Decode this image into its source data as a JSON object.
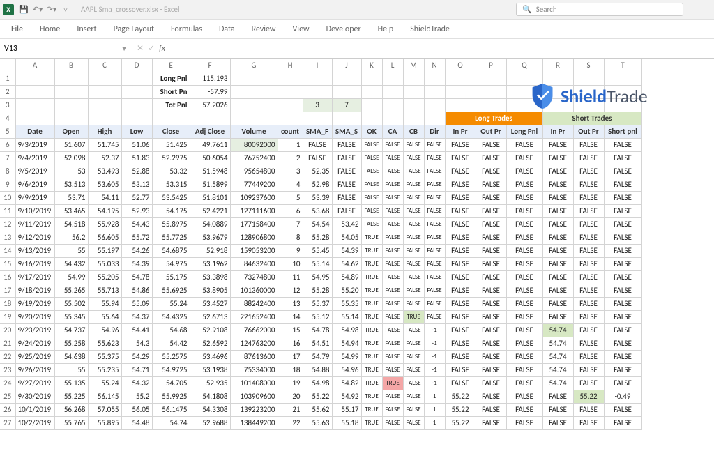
{
  "window": {
    "doc_title": "AAPL Sma_crossover.xlsx - Excel",
    "search_placeholder": "Search",
    "excel_glyph": "X"
  },
  "tabs": [
    "File",
    "Home",
    "Insert",
    "Page Layout",
    "Formulas",
    "Data",
    "Review",
    "View",
    "Developer",
    "Help",
    "ShieldTrade"
  ],
  "namebox": "V13",
  "logo": {
    "brand1": "Shield",
    "brand2": "Trade"
  },
  "summary": {
    "long_label": "Long Pnl",
    "long_val": "115.193",
    "short_label": "Short Pn",
    "short_val": "-57.99",
    "tot_label": "Tot Pnl",
    "tot_val": "57.2026",
    "cnt1": "3",
    "cnt2": "7"
  },
  "col_letters": [
    "A",
    "B",
    "C",
    "D",
    "E",
    "F",
    "G",
    "H",
    "I",
    "J",
    "K",
    "L",
    "M",
    "N",
    "O",
    "P",
    "Q",
    "R",
    "S",
    "T"
  ],
  "span_long": "Long Trades",
  "span_short": "Short Trades",
  "headers": [
    "Date",
    "Open",
    "High",
    "Low",
    "Close",
    "Adj Close",
    "Volume",
    "count",
    "SMA_F",
    "SMA_S",
    "OK",
    "CA",
    "CB",
    "Dir",
    "In Pr",
    "Out Pr",
    "Long Pnl",
    "In Pr",
    "Out Pr",
    "Short pnl"
  ],
  "rows": [
    [
      "9/3/2019",
      "51.607",
      "51.745",
      "51.06",
      "51.425",
      "49.7611",
      "80092000",
      "1",
      "FALSE",
      "FALSE",
      "FALSE",
      "FALSE",
      "FALSE",
      "FALSE",
      "FALSE",
      "FALSE",
      "FALSE",
      "FALSE",
      "FALSE",
      "FALSE"
    ],
    [
      "9/4/2019",
      "52.098",
      "52.37",
      "51.83",
      "52.2975",
      "50.6054",
      "76752400",
      "2",
      "FALSE",
      "FALSE",
      "FALSE",
      "FALSE",
      "FALSE",
      "FALSE",
      "FALSE",
      "FALSE",
      "FALSE",
      "FALSE",
      "FALSE",
      "FALSE"
    ],
    [
      "9/5/2019",
      "53",
      "53.493",
      "52.88",
      "53.32",
      "51.5948",
      "95654800",
      "3",
      "52.35",
      "FALSE",
      "FALSE",
      "FALSE",
      "FALSE",
      "FALSE",
      "FALSE",
      "FALSE",
      "FALSE",
      "FALSE",
      "FALSE",
      "FALSE"
    ],
    [
      "9/6/2019",
      "53.513",
      "53.605",
      "53.13",
      "53.315",
      "51.5899",
      "77449200",
      "4",
      "52.98",
      "FALSE",
      "FALSE",
      "FALSE",
      "FALSE",
      "FALSE",
      "FALSE",
      "FALSE",
      "FALSE",
      "FALSE",
      "FALSE",
      "FALSE"
    ],
    [
      "9/9/2019",
      "53.71",
      "54.11",
      "52.77",
      "53.5425",
      "51.8101",
      "109237600",
      "5",
      "53.39",
      "FALSE",
      "FALSE",
      "FALSE",
      "FALSE",
      "FALSE",
      "FALSE",
      "FALSE",
      "FALSE",
      "FALSE",
      "FALSE",
      "FALSE"
    ],
    [
      "9/10/2019",
      "53.465",
      "54.195",
      "52.93",
      "54.175",
      "52.4221",
      "127111600",
      "6",
      "53.68",
      "FALSE",
      "FALSE",
      "FALSE",
      "FALSE",
      "FALSE",
      "FALSE",
      "FALSE",
      "FALSE",
      "FALSE",
      "FALSE",
      "FALSE"
    ],
    [
      "9/11/2019",
      "54.518",
      "55.928",
      "54.43",
      "55.8975",
      "54.0889",
      "177158400",
      "7",
      "54.54",
      "53.42",
      "FALSE",
      "FALSE",
      "FALSE",
      "FALSE",
      "FALSE",
      "FALSE",
      "FALSE",
      "FALSE",
      "FALSE",
      "FALSE"
    ],
    [
      "9/12/2019",
      "56.2",
      "56.605",
      "55.72",
      "55.7725",
      "53.9679",
      "128906800",
      "8",
      "55.28",
      "54.05",
      "TRUE",
      "FALSE",
      "FALSE",
      "FALSE",
      "FALSE",
      "FALSE",
      "FALSE",
      "FALSE",
      "FALSE",
      "FALSE"
    ],
    [
      "9/13/2019",
      "55",
      "55.197",
      "54.26",
      "54.6875",
      "52.918",
      "159053200",
      "9",
      "55.45",
      "54.39",
      "TRUE",
      "FALSE",
      "FALSE",
      "FALSE",
      "FALSE",
      "FALSE",
      "FALSE",
      "FALSE",
      "FALSE",
      "FALSE"
    ],
    [
      "9/16/2019",
      "54.432",
      "55.033",
      "54.39",
      "54.975",
      "53.1962",
      "84632400",
      "10",
      "55.14",
      "54.62",
      "TRUE",
      "FALSE",
      "FALSE",
      "FALSE",
      "FALSE",
      "FALSE",
      "FALSE",
      "FALSE",
      "FALSE",
      "FALSE"
    ],
    [
      "9/17/2019",
      "54.99",
      "55.205",
      "54.78",
      "55.175",
      "53.3898",
      "73274800",
      "11",
      "54.95",
      "54.89",
      "TRUE",
      "FALSE",
      "FALSE",
      "FALSE",
      "FALSE",
      "FALSE",
      "FALSE",
      "FALSE",
      "FALSE",
      "FALSE"
    ],
    [
      "9/18/2019",
      "55.265",
      "55.713",
      "54.86",
      "55.6925",
      "53.8905",
      "101360000",
      "12",
      "55.28",
      "55.20",
      "TRUE",
      "FALSE",
      "FALSE",
      "FALSE",
      "FALSE",
      "FALSE",
      "FALSE",
      "FALSE",
      "FALSE",
      "FALSE"
    ],
    [
      "9/19/2019",
      "55.502",
      "55.94",
      "55.09",
      "55.24",
      "53.4527",
      "88242400",
      "13",
      "55.37",
      "55.35",
      "TRUE",
      "FALSE",
      "FALSE",
      "FALSE",
      "FALSE",
      "FALSE",
      "FALSE",
      "FALSE",
      "FALSE",
      "FALSE"
    ],
    [
      "9/20/2019",
      "55.345",
      "55.64",
      "54.37",
      "54.4325",
      "52.6713",
      "221652400",
      "14",
      "55.12",
      "55.14",
      "TRUE",
      "FALSE",
      "TRUE",
      "FALSE",
      "FALSE",
      "FALSE",
      "FALSE",
      "FALSE",
      "FALSE",
      "FALSE"
    ],
    [
      "9/23/2019",
      "54.737",
      "54.96",
      "54.41",
      "54.68",
      "52.9108",
      "76662000",
      "15",
      "54.78",
      "54.98",
      "TRUE",
      "FALSE",
      "FALSE",
      "-1",
      "FALSE",
      "FALSE",
      "FALSE",
      "54.74",
      "FALSE",
      "FALSE"
    ],
    [
      "9/24/2019",
      "55.258",
      "55.623",
      "54.3",
      "54.42",
      "52.6592",
      "124763200",
      "16",
      "54.51",
      "54.94",
      "TRUE",
      "FALSE",
      "FALSE",
      "-1",
      "FALSE",
      "FALSE",
      "FALSE",
      "54.74",
      "FALSE",
      "FALSE"
    ],
    [
      "9/25/2019",
      "54.638",
      "55.375",
      "54.29",
      "55.2575",
      "53.4696",
      "87613600",
      "17",
      "54.79",
      "54.99",
      "TRUE",
      "FALSE",
      "FALSE",
      "-1",
      "FALSE",
      "FALSE",
      "FALSE",
      "54.74",
      "FALSE",
      "FALSE"
    ],
    [
      "9/26/2019",
      "55",
      "55.235",
      "54.71",
      "54.9725",
      "53.1938",
      "75334000",
      "18",
      "54.88",
      "54.96",
      "TRUE",
      "FALSE",
      "FALSE",
      "-1",
      "FALSE",
      "FALSE",
      "FALSE",
      "54.74",
      "FALSE",
      "FALSE"
    ],
    [
      "9/27/2019",
      "55.135",
      "55.24",
      "54.32",
      "54.705",
      "52.935",
      "101408000",
      "19",
      "54.98",
      "54.82",
      "TRUE",
      "TRUE",
      "FALSE",
      "-1",
      "FALSE",
      "FALSE",
      "FALSE",
      "54.74",
      "FALSE",
      "FALSE"
    ],
    [
      "9/30/2019",
      "55.225",
      "56.145",
      "55.2",
      "55.9925",
      "54.1808",
      "103909600",
      "20",
      "55.22",
      "54.92",
      "TRUE",
      "FALSE",
      "FALSE",
      "1",
      "55.22",
      "FALSE",
      "FALSE",
      "FALSE",
      "55.22",
      "-0.49"
    ],
    [
      "10/1/2019",
      "56.268",
      "57.055",
      "56.05",
      "56.1475",
      "54.3308",
      "139223200",
      "21",
      "55.62",
      "55.17",
      "TRUE",
      "FALSE",
      "FALSE",
      "1",
      "55.22",
      "FALSE",
      "FALSE",
      "FALSE",
      "FALSE",
      "FALSE"
    ],
    [
      "10/2/2019",
      "55.765",
      "55.895",
      "54.48",
      "54.74",
      "52.9688",
      "138449200",
      "22",
      "55.63",
      "55.18",
      "TRUE",
      "FALSE",
      "FALSE",
      "1",
      "55.22",
      "FALSE",
      "FALSE",
      "FALSE",
      "FALSE",
      "FALSE"
    ]
  ]
}
